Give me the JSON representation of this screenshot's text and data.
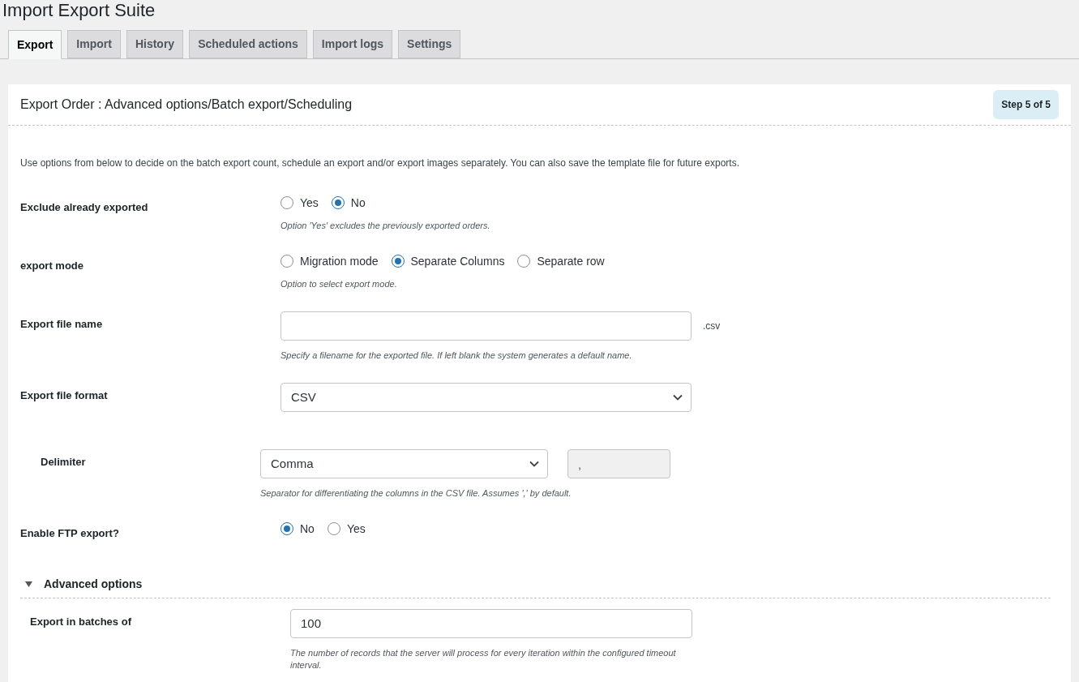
{
  "page_title": "Import Export Suite",
  "tabs": [
    {
      "label": "Export",
      "selected": true
    },
    {
      "label": "Import",
      "selected": false
    },
    {
      "label": "History",
      "selected": false
    },
    {
      "label": "Scheduled actions",
      "selected": false
    },
    {
      "label": "Import logs",
      "selected": false
    },
    {
      "label": "Settings",
      "selected": false
    }
  ],
  "panel": {
    "title": "Export Order : Advanced options/Batch export/Scheduling",
    "step": "Step 5 of 5",
    "intro": "Use options from below to decide on the batch export count, schedule an export and/or export images separately. You can also save the template file for future exports.",
    "fields": [
      {
        "kind": "radio",
        "label": "Exclude already exported",
        "options": [
          {
            "label": "Yes",
            "selected": false
          },
          {
            "label": "No",
            "selected": true
          }
        ],
        "help": "Option 'Yes' excludes the previously exported orders."
      },
      {
        "kind": "radio",
        "label": "export mode",
        "options": [
          {
            "label": "Migration mode",
            "selected": false
          },
          {
            "label": "Separate Columns",
            "selected": true
          },
          {
            "label": "Separate row",
            "selected": false
          }
        ],
        "help": "Option to select export mode."
      },
      {
        "kind": "text",
        "label": "Export file name",
        "suffix": ".csv",
        "help": "Specify a filename for the exported file. If left blank the system generates a default name."
      },
      {
        "kind": "select",
        "label": "Export file format",
        "value": "CSV",
        "children": [
          {
            "kind": "select",
            "label": "Delimiter",
            "value": "Comma",
            "extra_value": ",",
            "help": "Separator for differentiating the columns in the CSV file. Assumes ',' by default."
          }
        ]
      },
      {
        "kind": "radio",
        "label": "Enable FTP export?",
        "options": [
          {
            "label": "No",
            "selected": true
          },
          {
            "label": "Yes",
            "selected": false
          }
        ]
      }
    ],
    "advanced": {
      "title": "Advanced options",
      "expanded": true,
      "fields": [
        {
          "kind": "text",
          "label": "Export in batches of",
          "value": "100",
          "help": "The number of records that the server will process for every iteration within the configured timeout interval."
        }
      ]
    }
  }
}
